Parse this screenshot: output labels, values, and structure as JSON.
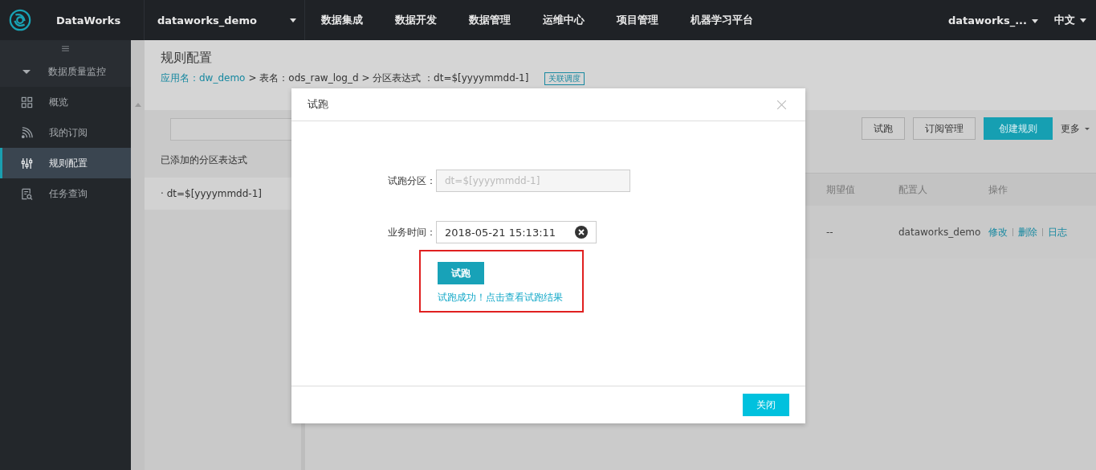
{
  "app": {
    "name": "DataWorks"
  },
  "top_nav": {
    "project": "dataworks_demo",
    "menu": [
      "数据集成",
      "数据开发",
      "数据管理",
      "运维中心",
      "项目管理",
      "机器学习平台"
    ],
    "user": "dataworks_...",
    "language": "中文"
  },
  "sidebar": {
    "section": {
      "label": "数据质量监控",
      "expanded": true
    },
    "items": [
      {
        "label": "概览",
        "selected": false
      },
      {
        "label": "我的订阅",
        "selected": false
      },
      {
        "label": "规则配置",
        "selected": true
      },
      {
        "label": "任务查询",
        "selected": false
      }
    ]
  },
  "page": {
    "title": "规则配置",
    "breadcrumb_link": "应用名：dw_demo",
    "breadcrumb_rest": "> 表名：ods_raw_log_d > 分区表达式 ：dt=$[yyyymmdd-1]",
    "badge": "关联调度"
  },
  "partitions": {
    "heading": "已添加的分区表达式",
    "items": [
      "· dt=$[yyyymmdd-1]"
    ]
  },
  "toolbar": {
    "buttons": [
      {
        "label": "试跑",
        "kind": "default"
      },
      {
        "label": "订阅管理",
        "kind": "default"
      },
      {
        "label": "创建规则",
        "kind": "primary"
      }
    ],
    "more": "更多"
  },
  "table": {
    "columns": [
      "期望值",
      "配置人",
      "操作"
    ],
    "rows": [
      {
        "cells": [
          "--",
          "dataworks_demo"
        ],
        "actions": [
          "修改",
          "删除",
          "日志"
        ]
      }
    ]
  },
  "dialog": {
    "title": "试跑",
    "fields": [
      {
        "label": "试跑分区：",
        "value": "dt=$[yyyymmdd-1]",
        "disabled": true,
        "clearable": false
      },
      {
        "label": "业务时间：",
        "value": "2018-05-21 15:13:11",
        "disabled": false,
        "clearable": true
      }
    ],
    "run_button": "试跑",
    "result_link": "试跑成功！点击查看试跑结果",
    "highlighted": true,
    "close_button": "关闭"
  }
}
